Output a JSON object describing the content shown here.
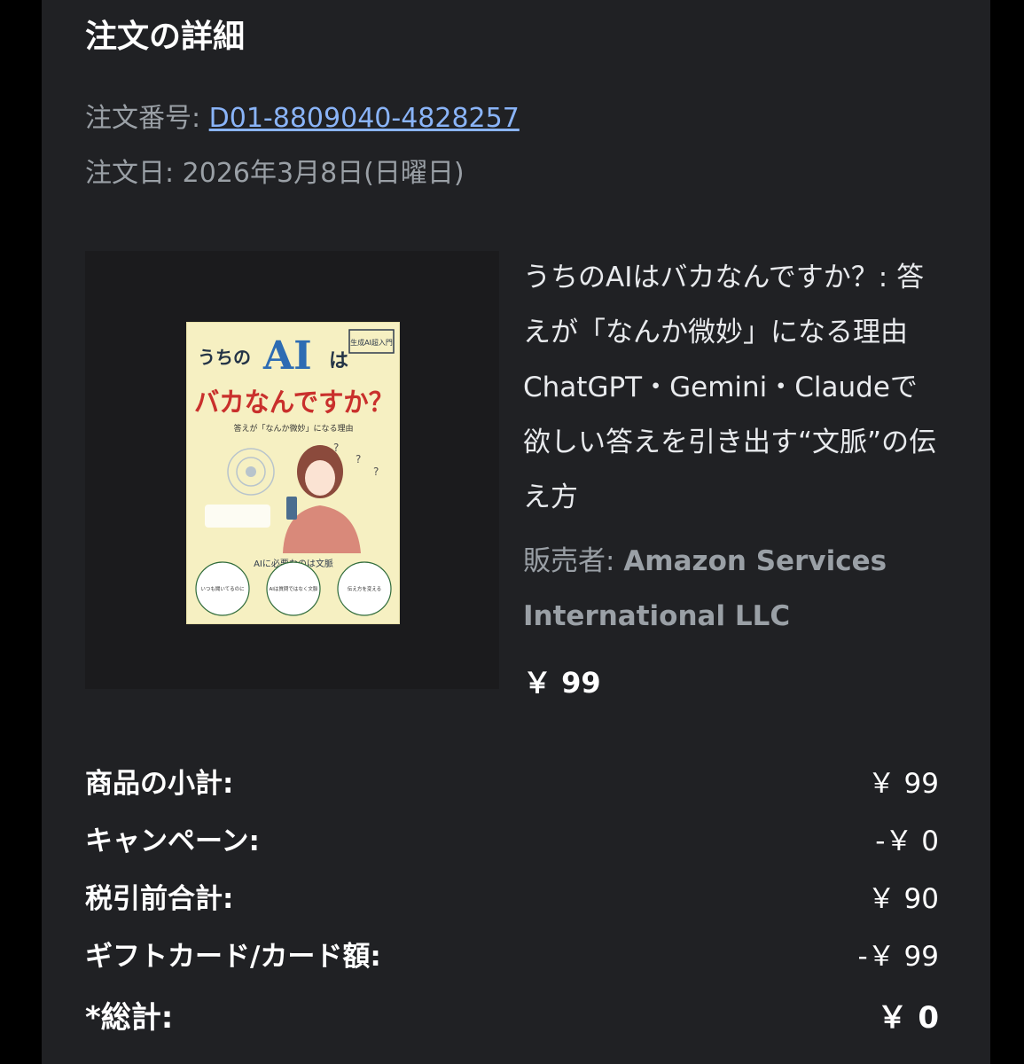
{
  "page": {
    "heading": "注文の詳細"
  },
  "order": {
    "number_label": "注文番号: ",
    "number": "D01-8809040-4828257",
    "date_label": "注文日: ",
    "date": "2026年3月8日(日曜日)"
  },
  "item": {
    "title": "うちのAIはバカなんですか？: 答えが「なんか微妙」になる理由 ChatGPT・Gemini・Claudeで欲しい答えを引き出す“文脈”の伝え方",
    "seller_label": "販売者: ",
    "seller_name": "Amazon Services International LLC",
    "price": "￥ 99",
    "cover": {
      "badge": "生成AI超入門",
      "title_line1": "うちの",
      "title_ai": "AI",
      "title_ha": "は",
      "title_line2": "バカなんですか？",
      "subtitle": "答えが「なんか微妙」になる理由",
      "band": "AIに必要なのは文脈",
      "circle1": "いつも聞いてるのに",
      "circle2": "AIは質問ではなく文脈",
      "circle3": "伝え方を変える"
    }
  },
  "summary": [
    {
      "label": "商品の小計:",
      "value": "￥ 99"
    },
    {
      "label": "キャンペーン:",
      "value": "-￥ 0"
    },
    {
      "label": "税引前合計:",
      "value": "￥ 90"
    },
    {
      "label": "ギフトカード/カード額:",
      "value": "-￥ 99"
    },
    {
      "label": "*総計:",
      "value": "￥ 0"
    }
  ]
}
